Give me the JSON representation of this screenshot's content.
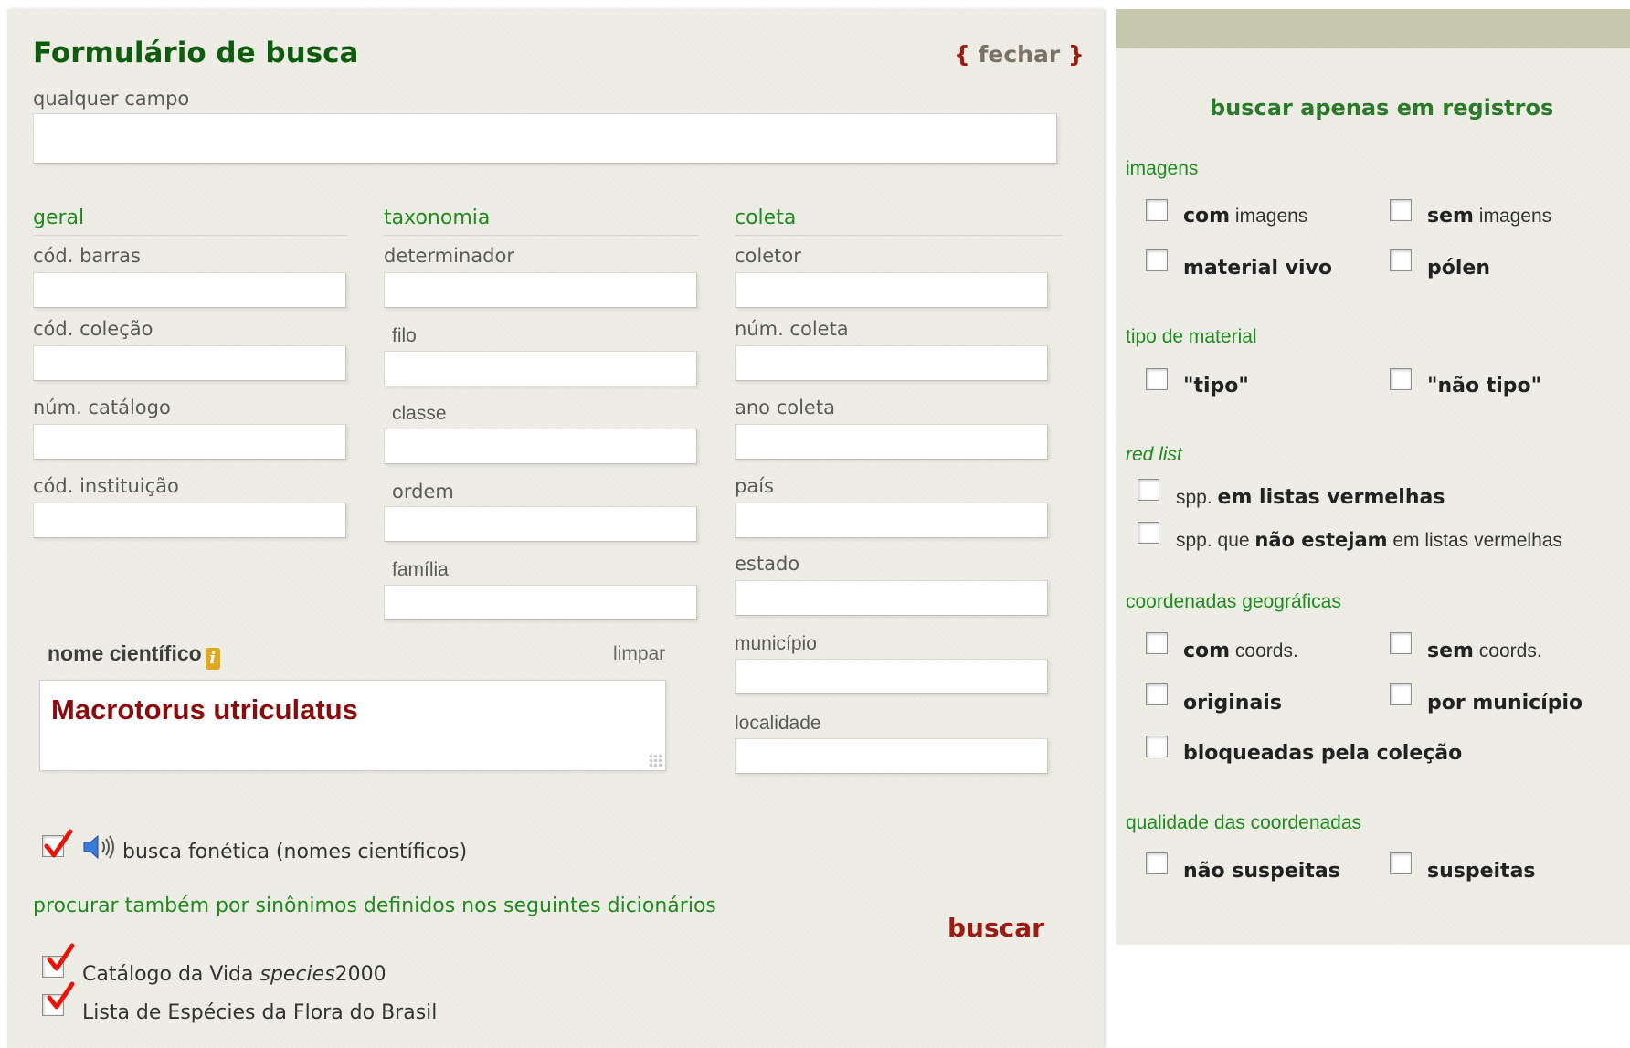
{
  "form": {
    "title": "Formulário de busca",
    "close_open": "{",
    "close_label": "fechar",
    "close_close": "}",
    "any_field_label": "qualquer campo",
    "any_field_value": ""
  },
  "columns": {
    "geral": {
      "header": "geral",
      "fields": [
        "cód. barras",
        "cód. coleção",
        "núm. catálogo",
        "cód. instituição"
      ]
    },
    "taxonomia": {
      "header": "taxonomia",
      "fields": [
        "determinador",
        "filo",
        "classe",
        "ordem",
        "família"
      ]
    },
    "coleta": {
      "header": "coleta",
      "fields": [
        "coletor",
        "núm. coleta",
        "ano coleta",
        "país",
        "estado",
        "município",
        "localidade"
      ]
    }
  },
  "scientific_name": {
    "label": "nome científico",
    "help_icon": "i",
    "clear_label": "limpar",
    "value": "Macrotorus utriculatus"
  },
  "phonetic": {
    "checked": true,
    "label": "busca fonética (nomes científicos)",
    "icon": "speaker-icon"
  },
  "synonyms": {
    "label": "procurar também por sinônimos definidos nos seguintes dicionários",
    "dict1_prefix": "Catálogo da Vida ",
    "dict1_italic": "species",
    "dict1_suffix": "2000",
    "dict1_checked": true,
    "dict2_label": "Lista de Espécies da Flora do Brasil",
    "dict2_checked": true
  },
  "search_button": "buscar",
  "filters": {
    "title": "buscar apenas em registros",
    "imagens": {
      "header": "imagens",
      "com_bold": "com",
      "com_rest": " imagens",
      "sem_bold": "sem",
      "sem_rest": " imagens",
      "vivo": "material vivo",
      "polen": "pólen"
    },
    "tipo": {
      "header": "tipo de material",
      "tipo": "\"tipo\"",
      "nao_tipo": "\"não tipo\""
    },
    "redlist": {
      "header": "red list",
      "opt1_prefix": "spp. ",
      "opt1_bold": "em listas vermelhas",
      "opt2_prefix": "spp. que ",
      "opt2_bold": "não estejam",
      "opt2_suffix": " em listas vermelhas"
    },
    "coords": {
      "header": "coordenadas geográficas",
      "com_bold": "com",
      "com_rest": " coords.",
      "sem_bold": "sem",
      "sem_rest": " coords.",
      "originais": "originais",
      "municipio": "por município",
      "bloqueadas": "bloqueadas pela coleção"
    },
    "qualidade": {
      "header": "qualidade das coordenadas",
      "nao_suspeitas": "não suspeitas",
      "suspeitas": "suspeitas"
    }
  },
  "colors": {
    "title_green": "#0e5c0e",
    "label_green": "#1f8a1f",
    "action_red": "#9b1c12",
    "sci_name_red": "#8b0c0c",
    "panel_bg": "#efeee6",
    "topbar": "#c6c8b0"
  }
}
